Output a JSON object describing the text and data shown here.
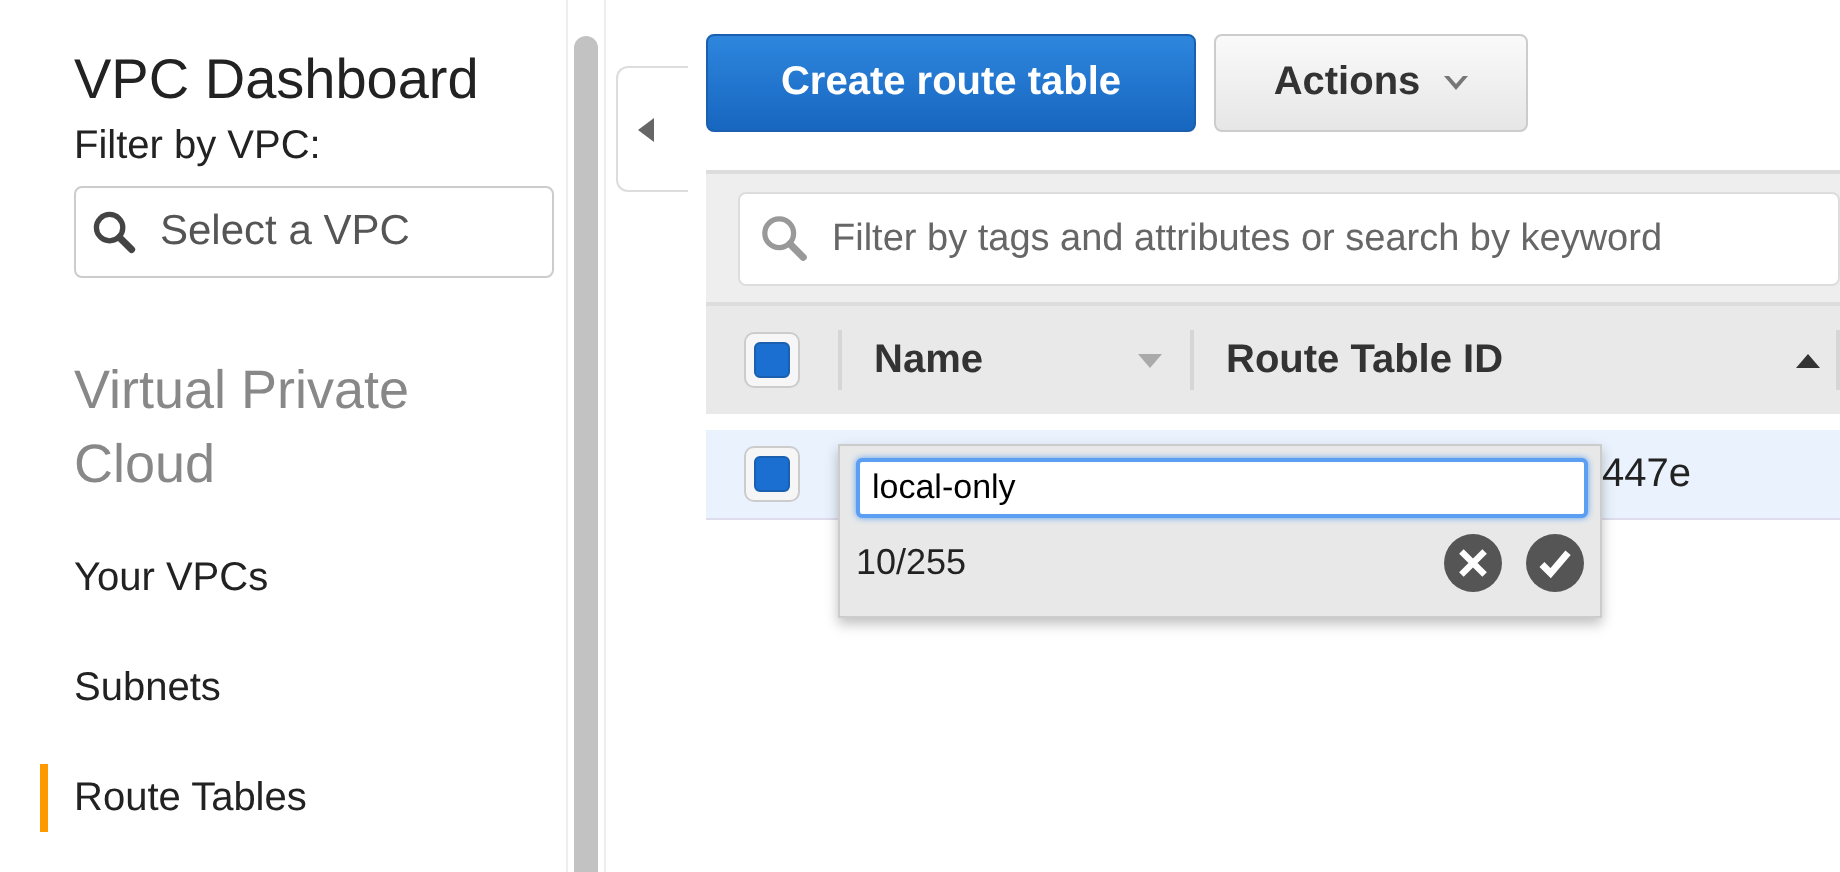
{
  "sidebar": {
    "title": "VPC Dashboard",
    "filter_label": "Filter by VPC:",
    "filter": {
      "placeholder": "Select a VPC"
    },
    "section_title": "Virtual Private Cloud",
    "items": [
      {
        "label": "Your VPCs",
        "selected": false
      },
      {
        "label": "Subnets",
        "selected": false
      },
      {
        "label": "Route Tables",
        "selected": true
      }
    ]
  },
  "toolbar": {
    "create_button": "Create route table",
    "actions_button": "Actions"
  },
  "search": {
    "placeholder": "Filter by tags and attributes or search by keyword"
  },
  "table": {
    "header_checked": true,
    "columns": [
      {
        "label": "Name",
        "sorted": false
      },
      {
        "label": "Route Table ID",
        "sorted": true
      }
    ],
    "rows": [
      {
        "checked": true,
        "selected": true,
        "route_table_id": "447e"
      }
    ]
  },
  "editor": {
    "value": "local-only",
    "counter": "10/255"
  }
}
